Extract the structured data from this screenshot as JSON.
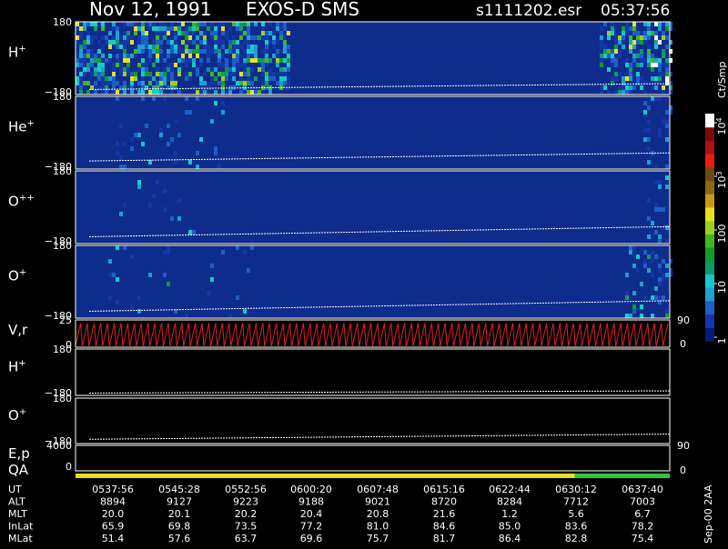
{
  "header": {
    "date": "Nov 12, 1991",
    "mission": "EXOS-D SMS",
    "file": "s1111202.esr",
    "time": "05:37:56"
  },
  "colorbar": {
    "unit": "Ct/Smp",
    "ticks": [
      {
        "label": "1",
        "value": 1
      },
      {
        "label": "10",
        "value": 10
      },
      {
        "label": "100",
        "value": 100
      },
      {
        "label": "10",
        "sup": "3",
        "value": 1000
      },
      {
        "label": "10",
        "sup": "4",
        "value": 10000
      }
    ],
    "range": [
      1,
      10000
    ],
    "colors": [
      "#0a1a7a",
      "#1436a8",
      "#1e5ec8",
      "#1fa0d0",
      "#19c9c9",
      "#0f9a6a",
      "#169b28",
      "#3fb81e",
      "#9fd020",
      "#e8e020",
      "#c89a14",
      "#8a6a10",
      "#6a4a10",
      "#e02010",
      "#b01010",
      "#7a0a0a",
      "#ffffff"
    ]
  },
  "chart_data": [
    {
      "type": "heatmap",
      "label": "H",
      "sup": "+",
      "ytick_top": "180",
      "ytick_bottom": "−180",
      "ylim": [
        -180,
        180
      ],
      "line": {
        "start": -155,
        "end": -126
      },
      "intensity": {
        "left_band": [
          0,
          0.36
        ],
        "left_level": 0.62,
        "right_band": [
          0.88,
          1.0
        ],
        "right_level": 0.55
      }
    },
    {
      "type": "heatmap",
      "label": "He",
      "sup": "+",
      "ytick_top": "180",
      "ytick_bottom": "−180",
      "ylim": [
        -180,
        180
      ],
      "line": {
        "start": -140,
        "end": -100
      },
      "intensity": {
        "left_band": [
          0.05,
          0.25
        ],
        "left_level": 0.08,
        "right_band": [
          0.95,
          1.0
        ],
        "right_level": 0.25
      }
    },
    {
      "type": "heatmap",
      "label": "O",
      "sup": "++",
      "ytick_top": "180",
      "ytick_bottom": "−180",
      "ylim": [
        -180,
        180
      ],
      "line": {
        "start": -146,
        "end": -96
      },
      "intensity": {
        "left_band": [
          0.05,
          0.2
        ],
        "left_level": 0.03,
        "right_band": [
          0.95,
          1.0
        ],
        "right_level": 0.12
      }
    },
    {
      "type": "heatmap",
      "label": "O",
      "sup": "+",
      "ytick_top": "180",
      "ytick_bottom": "−180",
      "ylim": [
        -180,
        180
      ],
      "line": {
        "start": -146,
        "end": -94
      },
      "intensity": {
        "left_band": [
          0.05,
          0.3
        ],
        "left_level": 0.05,
        "right_band": [
          0.92,
          1.0
        ],
        "right_level": 0.2
      }
    },
    {
      "type": "line",
      "label": "V,r",
      "ytick_top": "25",
      "ytick_bottom": "0",
      "right_tick_top": "90",
      "right_tick_bottom": "0",
      "ylim": [
        0,
        25
      ],
      "series": {
        "color": "#e02020",
        "cycles": 88,
        "low": 1,
        "high": 22
      }
    },
    {
      "type": "line",
      "label": "H",
      "sup": "+",
      "ytick_top": "180",
      "ytick_bottom": "−180",
      "ylim": [
        -180,
        180
      ],
      "line": {
        "start": -162,
        "end": -145
      }
    },
    {
      "type": "line",
      "label": "O",
      "sup": "+",
      "ytick_top": "180",
      "ytick_bottom": "−180",
      "ylim": [
        -180,
        180
      ],
      "line": {
        "start": -146,
        "end": -105
      }
    },
    {
      "type": "line",
      "label": "E,p",
      "ytick_top": "4000",
      "right_tick_top": "90",
      "ylim": [
        0,
        4000
      ]
    },
    {
      "type": "bar",
      "label": "QA",
      "ytick_bottom": "0",
      "right_tick_bottom": "0",
      "segments": [
        {
          "from": 0,
          "to": 0.84,
          "color": "#e8e020"
        },
        {
          "from": 0.84,
          "to": 1.0,
          "color": "#2cc83c"
        }
      ]
    }
  ],
  "table": {
    "rows": [
      {
        "label": "UT",
        "values": [
          "0537:56",
          "0545:28",
          "0552:56",
          "0600:20",
          "0607:48",
          "0615:16",
          "0622:44",
          "0630:12",
          "0637:40"
        ]
      },
      {
        "label": "ALT",
        "values": [
          "8894",
          "9127",
          "9223",
          "9188",
          "9021",
          "8720",
          "8284",
          "7712",
          "7003"
        ]
      },
      {
        "label": "MLT",
        "values": [
          "20.0",
          "20.1",
          "20.2",
          "20.4",
          "20.8",
          "21.6",
          "1.2",
          "5.6",
          "6.7"
        ]
      },
      {
        "label": "InLat",
        "values": [
          "65.9",
          "69.8",
          "73.5",
          "77.2",
          "81.0",
          "84.6",
          "85.0",
          "83.6",
          "78.2"
        ]
      },
      {
        "label": "MLat",
        "values": [
          "51.4",
          "57.6",
          "63.7",
          "69.6",
          "75.7",
          "81.7",
          "86.4",
          "82.8",
          "75.4"
        ]
      }
    ]
  },
  "footer_note": "Sep-00 2AA"
}
